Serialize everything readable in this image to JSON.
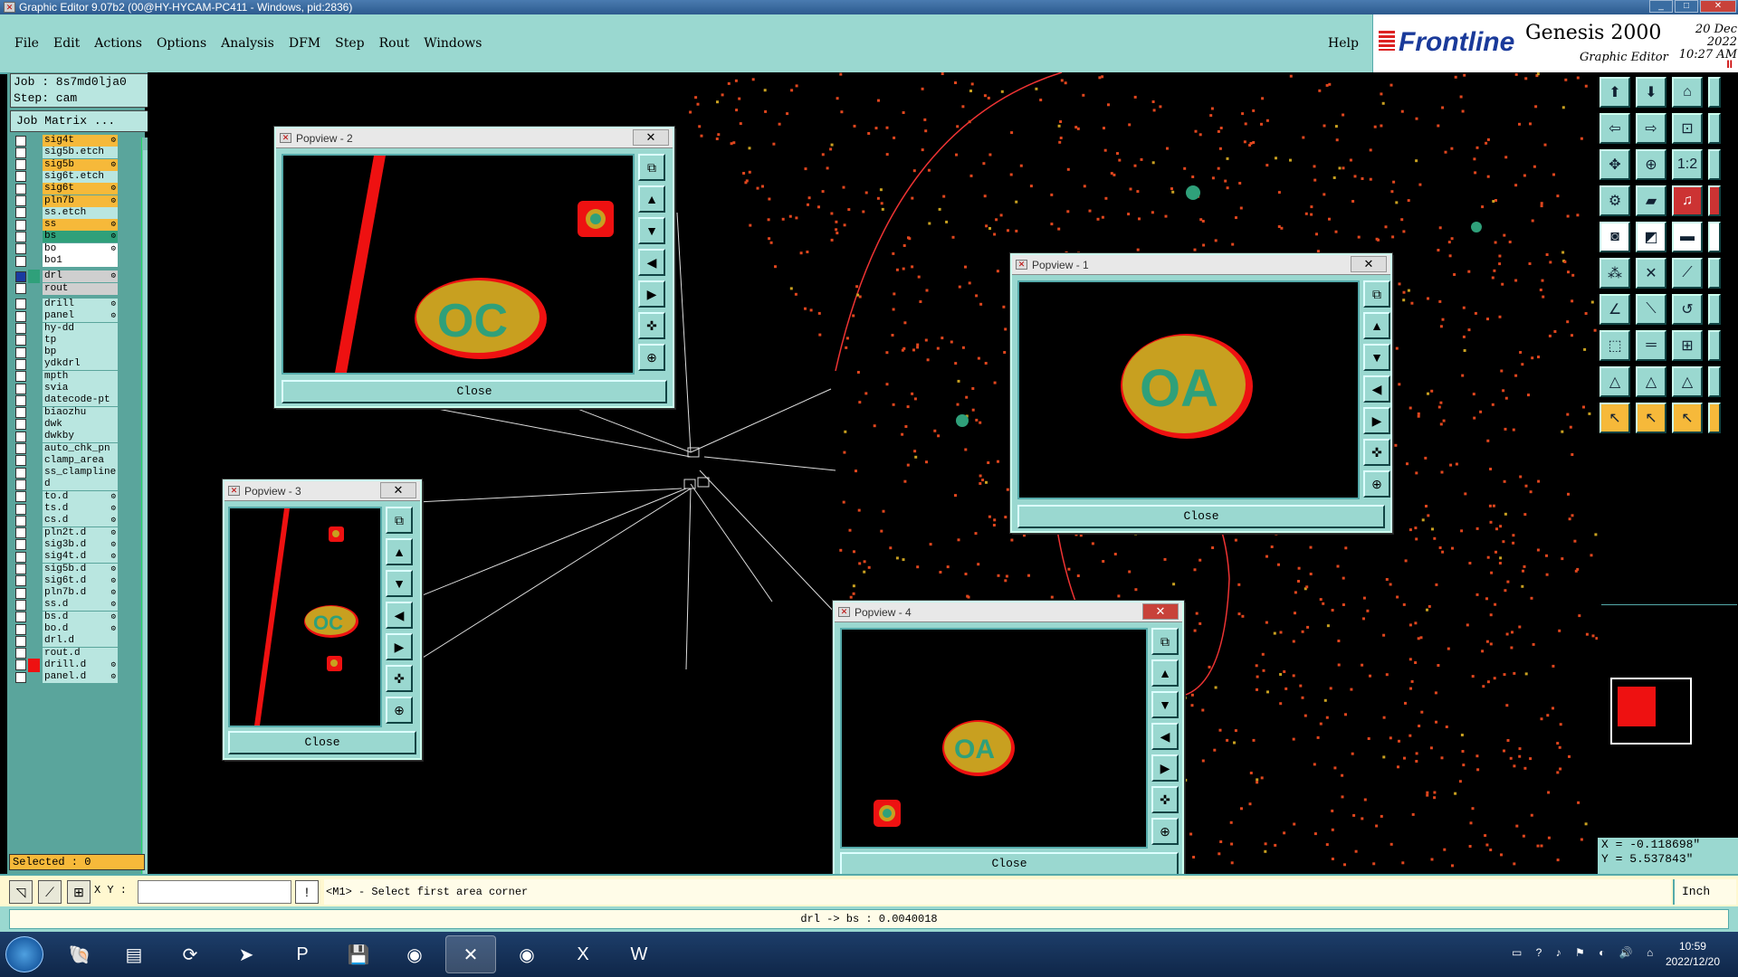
{
  "window": {
    "title": "Graphic Editor 9.07b2 (00@HY-HYCAM-PC411 - Windows, pid:2836)"
  },
  "menubar": {
    "items": [
      "File",
      "Edit",
      "Actions",
      "Options",
      "Analysis",
      "DFM",
      "Step",
      "Rout",
      "Windows"
    ],
    "help": "Help"
  },
  "brand": {
    "logo": "Frontline",
    "product": "Genesis 2000",
    "subtitle": "Graphic Editor",
    "date_line1": "20 Dec 2022",
    "date_line2": "10:27 AM"
  },
  "job": {
    "job_label": "Job : 8s7md0lja0",
    "step_label": "Step: cam",
    "matrix_button": "Job Matrix ..."
  },
  "layers": [
    {
      "name": "sig4t",
      "style": "hl",
      "mark": "⚙"
    },
    {
      "name": "sig5b.etch",
      "style": "",
      "mark": ""
    },
    {
      "name": "sig5b",
      "style": "hl",
      "mark": "⚙"
    },
    {
      "name": "sig6t.etch",
      "style": "",
      "mark": ""
    },
    {
      "name": "sig6t",
      "style": "hl",
      "mark": "⚙"
    },
    {
      "name": "pln7b",
      "style": "hl",
      "mark": "⚙"
    },
    {
      "name": "ss.etch",
      "style": "",
      "mark": ""
    },
    {
      "name": "ss",
      "style": "hl",
      "mark": "⚙"
    },
    {
      "name": "bs",
      "style": "green",
      "mark": "⚙"
    },
    {
      "name": "bo",
      "style": "white",
      "mark": "⚙"
    },
    {
      "name": "bo1",
      "style": "white",
      "mark": ""
    },
    {
      "name": "drl",
      "style": "grey",
      "mark": "⚙"
    },
    {
      "name": "rout",
      "style": "grey",
      "mark": ""
    },
    {
      "name": "drill",
      "style": "",
      "mark": "⚙"
    },
    {
      "name": "panel",
      "style": "",
      "mark": "⚙"
    },
    {
      "name": "hy-dd",
      "style": "",
      "mark": ""
    },
    {
      "name": "tp",
      "style": "",
      "mark": ""
    },
    {
      "name": "bp",
      "style": "",
      "mark": ""
    },
    {
      "name": "ydkdrl",
      "style": "",
      "mark": ""
    },
    {
      "name": "mpth",
      "style": "",
      "mark": ""
    },
    {
      "name": "svia",
      "style": "",
      "mark": ""
    },
    {
      "name": "datecode-pt",
      "style": "",
      "mark": ""
    },
    {
      "name": "biaozhu",
      "style": "",
      "mark": ""
    },
    {
      "name": "dwk",
      "style": "",
      "mark": ""
    },
    {
      "name": "dwkby",
      "style": "",
      "mark": ""
    },
    {
      "name": "auto_chk_pn",
      "style": "",
      "mark": ""
    },
    {
      "name": "clamp_area",
      "style": "",
      "mark": ""
    },
    {
      "name": "ss_clampline",
      "style": "",
      "mark": ""
    },
    {
      "name": "d",
      "style": "",
      "mark": ""
    },
    {
      "name": "to.d",
      "style": "",
      "mark": "⚙"
    },
    {
      "name": "ts.d",
      "style": "",
      "mark": "⚙"
    },
    {
      "name": "cs.d",
      "style": "",
      "mark": "⚙"
    },
    {
      "name": "pln2t.d",
      "style": "",
      "mark": "⚙"
    },
    {
      "name": "sig3b.d",
      "style": "",
      "mark": "⚙"
    },
    {
      "name": "sig4t.d",
      "style": "",
      "mark": "⚙"
    },
    {
      "name": "sig5b.d",
      "style": "",
      "mark": "⚙"
    },
    {
      "name": "sig6t.d",
      "style": "",
      "mark": "⚙"
    },
    {
      "name": "pln7b.d",
      "style": "",
      "mark": "⚙"
    },
    {
      "name": "ss.d",
      "style": "",
      "mark": "⚙"
    },
    {
      "name": "bs.d",
      "style": "",
      "mark": "⚙"
    },
    {
      "name": "bo.d",
      "style": "",
      "mark": "⚙"
    },
    {
      "name": "drl.d",
      "style": "",
      "mark": ""
    },
    {
      "name": "rout.d",
      "style": "",
      "mark": ""
    },
    {
      "name": "drill.d",
      "style": "",
      "mark": "⚙"
    },
    {
      "name": "panel.d",
      "style": "",
      "mark": "⚙"
    }
  ],
  "selected_label": "Selected : 0",
  "popviews": [
    {
      "title": "Popview - 2",
      "close_label": "Close"
    },
    {
      "title": "Popview - 1",
      "close_label": "Close"
    },
    {
      "title": "Popview - 3",
      "close_label": "Close"
    },
    {
      "title": "Popview - 4",
      "close_label": "Close"
    }
  ],
  "coords": {
    "x": "X = -0.118698\"",
    "y": "Y = 5.537843\""
  },
  "command": {
    "xy_label": "X Y :",
    "xy_value": "",
    "message": "<M1> - Select first area corner",
    "unit": "Inch"
  },
  "status": {
    "text": "drl -> bs : 0.0040018"
  },
  "taskbar": {
    "time": "10:59",
    "date": "2022/12/20"
  },
  "colors": {
    "panel_cyan": "#9ad8d0",
    "layer_highlight": "#f6b93a",
    "pad_red": "#e11",
    "pad_green": "#2fa07a",
    "pad_yellow": "#c8a020"
  }
}
